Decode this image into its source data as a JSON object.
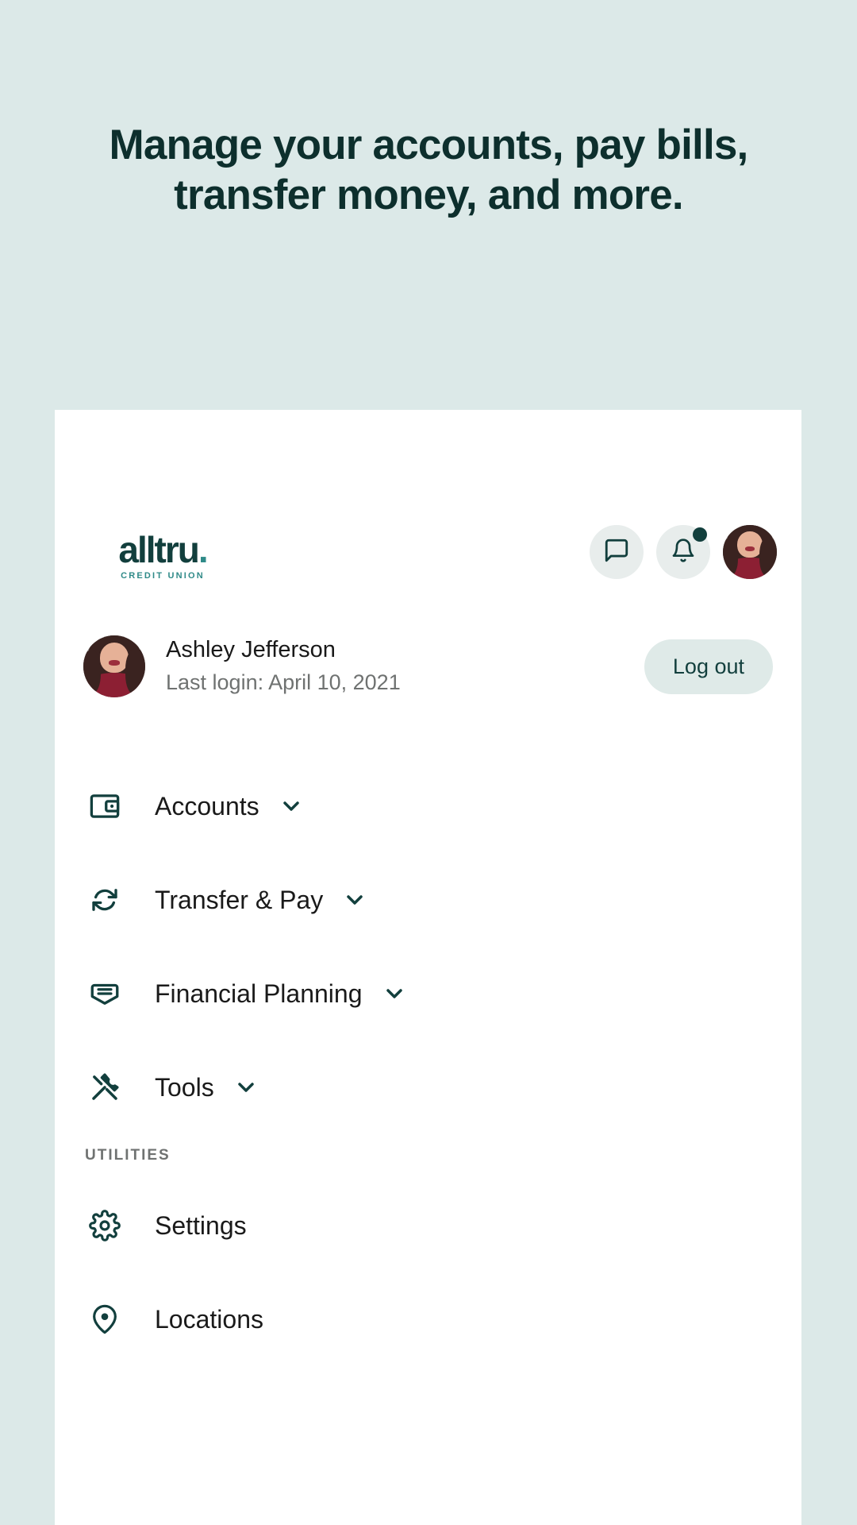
{
  "theme": {
    "page_bg": "#dce9e8",
    "card_bg": "#ffffff",
    "brand_dark": "#123f3d",
    "brand_teal": "#2f8a88",
    "heading_color": "#0d2f2d",
    "muted_text": "#6f7271",
    "logout_bg": "#dfeae8",
    "icon_circle_bg": "#e8edec",
    "badge_color": "#123f3d"
  },
  "hero": {
    "title": "Manage your accounts, pay bills, transfer money, and more."
  },
  "card": {
    "header": {
      "logo": {
        "word": "alltru",
        "dot": ".",
        "subtitle": "CREDIT UNION"
      },
      "actions": [
        {
          "name": "messages-icon",
          "label": "Messages",
          "badge": false
        },
        {
          "name": "bell-icon",
          "label": "Notifications",
          "badge": true
        },
        {
          "name": "avatar",
          "label": "Account avatar",
          "badge": false
        }
      ]
    },
    "profile": {
      "avatar_alt": "Ashley Jefferson avatar",
      "name": "Ashley Jefferson",
      "last_login": "Last login: April 10, 2021",
      "logout_label": "Log out"
    },
    "nav": {
      "primary": [
        {
          "label": "Accounts",
          "icon": "wallet-icon",
          "chevron": true
        },
        {
          "label": "Transfer & Pay",
          "icon": "transfer-icon",
          "chevron": true
        },
        {
          "label": "Financial Planning",
          "icon": "envelope-icon",
          "chevron": true
        },
        {
          "label": "Tools",
          "icon": "tools-icon",
          "chevron": true
        }
      ],
      "utilities_title": "UTILITIES",
      "utilities": [
        {
          "label": "Settings",
          "icon": "gear-icon",
          "chevron": false
        },
        {
          "label": "Locations",
          "icon": "map-pin-icon",
          "chevron": false
        }
      ]
    }
  }
}
